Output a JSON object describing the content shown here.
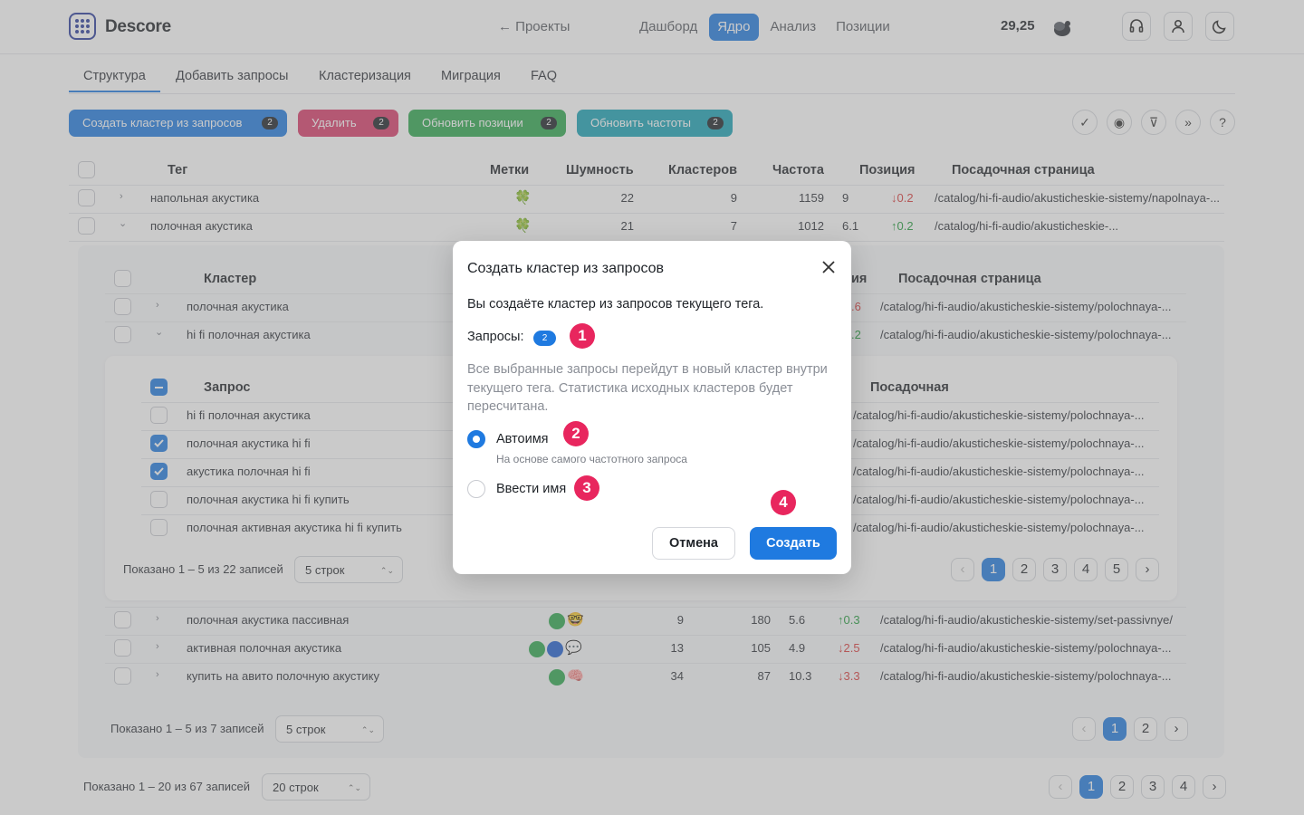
{
  "header": {
    "logo_text": "Descore",
    "back_link": "← Проекты",
    "nav": [
      "Дашборд",
      "Ядро",
      "Анализ",
      "Позиции"
    ],
    "active_nav": "Ядро",
    "balance": "29,25",
    "icons": [
      "headset-icon",
      "user-icon",
      "moon-icon"
    ]
  },
  "tabs": [
    "Структура",
    "Добавить запросы",
    "Кластеризация",
    "Миграция",
    "FAQ"
  ],
  "actions": {
    "create_cluster": {
      "label": "Создать кластер из запросов",
      "count": "2",
      "color": "#1f7ae0"
    },
    "delete": {
      "label": "Удалить",
      "count": "2",
      "color": "#d93b6a"
    },
    "update_positions": {
      "label": "Обновить позиции",
      "count": "2",
      "color": "#2ea84f"
    },
    "update_frequency": {
      "label": "Обновить частоты",
      "count": "2",
      "color": "#19a2b5"
    },
    "tools": [
      "check-double-icon",
      "eye-icon",
      "filter-icon",
      "chevrons-right-icon",
      "help-icon"
    ]
  },
  "tag_table": {
    "headers": {
      "tag": "Тег",
      "marks": "Метки",
      "noise": "Шумность",
      "clusters": "Кластеров",
      "freq": "Частота",
      "pos": "Позиция",
      "page": "Посадочная страница"
    },
    "rows": [
      {
        "tag": "напольная акустика",
        "noise": "22",
        "clusters": "9",
        "freq": "1159",
        "pos": "9",
        "delta": "↓0.2",
        "page": "/catalog/hi-fi-audio/akusticheskie-sistemy/napolnaya-..."
      },
      {
        "tag": "полочная акустика",
        "noise": "21",
        "clusters": "7",
        "freq": "1012",
        "pos": "6.1",
        "delta": "↑0.2",
        "page": "/catalog/hi-fi-audio/akusticheskie-..."
      }
    ]
  },
  "cluster_table": {
    "headers": {
      "cluster": "Кластер",
      "pos_partial": "ия",
      "page": "Посадочная страница"
    },
    "rows_top": [
      {
        "name": "полочная акустика",
        "delta": ".6",
        "page": "/catalog/hi-fi-audio/akusticheskie-sistemy/polochnaya-..."
      },
      {
        "name": "hi fi полочная акустика",
        "delta": ".2",
        "page": "/catalog/hi-fi-audio/akusticheskie-sistemy/polochnaya-..."
      }
    ],
    "rows_bottom": [
      {
        "name": "полочная акустика пассивная",
        "noise": "9",
        "freq": "180",
        "pos": "5.6",
        "delta": "↑0.3",
        "page": "/catalog/hi-fi-audio/akusticheskie-sistemy/set-passivnye/"
      },
      {
        "name": "активная полочная акустика",
        "noise": "13",
        "freq": "105",
        "pos": "4.9",
        "delta": "↓2.5",
        "page": "/catalog/hi-fi-audio/akusticheskie-sistemy/polochnaya-..."
      },
      {
        "name": "купить на авито полочную акустику",
        "noise": "34",
        "freq": "87",
        "pos": "10.3",
        "delta": "↓3.3",
        "page": "/catalog/hi-fi-audio/akusticheskie-sistemy/polochnaya-..."
      }
    ],
    "footer": {
      "shown": "Показано 1 – 5 из 7 записей",
      "rows_select": "5 строк",
      "pages": [
        "1",
        "2"
      ]
    }
  },
  "query_table": {
    "headers": {
      "query": "Запрос",
      "page": "Посадочная"
    },
    "rows": [
      {
        "query": "hi fi полочная акустика",
        "checked": false,
        "page": "/catalog/hi-fi-audio/akusticheskie-sistemy/polochnaya-..."
      },
      {
        "query": "полочная акустика hi fi",
        "checked": true,
        "page": "/catalog/hi-fi-audio/akusticheskie-sistemy/polochnaya-..."
      },
      {
        "query": "акустика полочная hi fi",
        "checked": true,
        "page": "/catalog/hi-fi-audio/akusticheskie-sistemy/polochnaya-..."
      },
      {
        "query": "полочная акустика hi fi купить",
        "checked": false,
        "page": "/catalog/hi-fi-audio/akusticheskie-sistemy/polochnaya-..."
      },
      {
        "query": "полочная активная акустика hi fi купить",
        "checked": false,
        "page": "/catalog/hi-fi-audio/akusticheskie-sistemy/polochnaya-..."
      }
    ],
    "footer": {
      "shown": "Показано 1 – 5 из 22 записей",
      "rows_select": "5 строк",
      "pages": [
        "1",
        "2",
        "3",
        "4",
        "5"
      ]
    }
  },
  "main_footer": {
    "shown": "Показано 1 – 20 из 67 записей",
    "rows_select": "20 строк",
    "pages": [
      "1",
      "2",
      "3",
      "4"
    ]
  },
  "modal": {
    "title": "Создать кластер из запросов",
    "description": "Вы создаёте кластер из запросов текущего тега.",
    "requests_label": "Запросы:",
    "requests_count": "2",
    "note": "Все выбранные запросы перейдут в новый кластер внутри текущего тега. Статистика исходных кластеров будет пересчитана.",
    "option_auto": "Автоимя",
    "option_auto_hint": "На основе самого частотного запроса",
    "option_manual": "Ввести имя",
    "selected_option": "auto",
    "cancel": "Отмена",
    "create": "Создать",
    "markers": [
      "1",
      "2",
      "3",
      "4"
    ]
  }
}
